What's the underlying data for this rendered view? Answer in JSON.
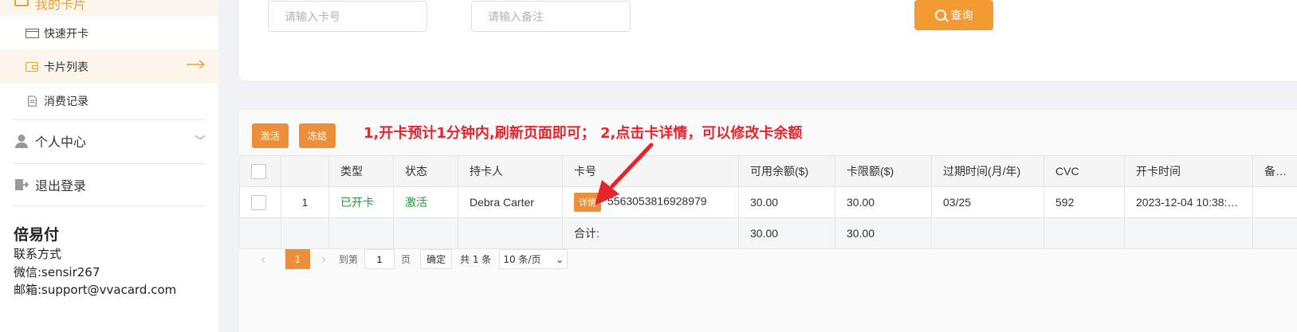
{
  "sidebar": {
    "group_label": "我的卡片",
    "items": [
      {
        "label": "快速开卡",
        "icon": "card-icon"
      },
      {
        "label": "卡片列表",
        "icon": "wallet-icon",
        "active": true
      },
      {
        "label": "消费记录",
        "icon": "document-icon"
      }
    ],
    "menus": [
      {
        "label": "个人中心",
        "icon": "user-icon"
      },
      {
        "label": "退出登录",
        "icon": "logout-icon"
      }
    ],
    "brand": "倍易付",
    "contact_title": "联系方式",
    "wechat": "微信:sensir267",
    "email": "邮箱:support@vvacard.com"
  },
  "search": {
    "card_placeholder": "请输入卡号",
    "remark_placeholder": "请输入备注",
    "query_label": "查询"
  },
  "toolbar": {
    "activate_label": "激活",
    "freeze_label": "冻结",
    "notice": "1,开卡预计1分钟内,刷新页面即可；  2,点击卡详情，可以修改卡余额"
  },
  "table": {
    "headers": [
      "",
      "",
      "类型",
      "状态",
      "持卡人",
      "卡号",
      "可用余额($)",
      "卡限额($)",
      "过期时间(月/年)",
      "CVC",
      "开卡时间",
      "备注"
    ],
    "rows": [
      {
        "index": "1",
        "type": "已开卡",
        "status": "激活",
        "holder": "Debra Carter",
        "detail_label": "详情",
        "card_number": "5563053816928979",
        "balance": "30.00",
        "limit": "30.00",
        "expiry": "03/25",
        "cvc": "592",
        "opened_at": "2023-12-04 10:38:…",
        "remark": ""
      }
    ],
    "summary": {
      "label": "合计:",
      "balance": "30.00",
      "limit": "30.00"
    }
  },
  "pagination": {
    "prev": "‹",
    "current": "1",
    "next": "›",
    "goto_label": "到第",
    "goto_value": "1",
    "page_unit": "页",
    "confirm_label": "确定",
    "total": "共 1 条",
    "page_size": "10 条/页"
  },
  "colors": {
    "accent": "#ed8f3a",
    "notice": "#e8242b",
    "status_green": "#1f9a36"
  }
}
